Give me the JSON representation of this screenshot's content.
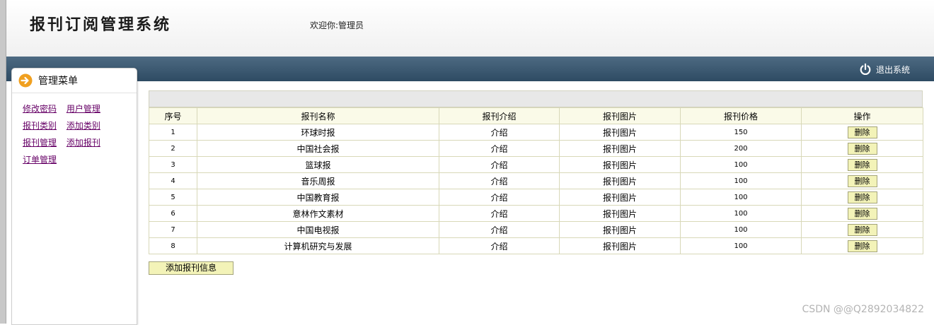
{
  "header": {
    "app_title": "报刊订阅管理系统",
    "welcome": "欢迎你:管理员"
  },
  "navbar": {
    "logout_label": "退出系统",
    "logout_icon": "power-icon"
  },
  "sidebar": {
    "title": "管理菜单",
    "title_icon": "arrow-right-circle-icon",
    "menu_rows": [
      [
        "修改密码",
        "用户管理"
      ],
      [
        "报刊类别",
        "添加类别"
      ],
      [
        "报刊管理",
        "添加报刊"
      ],
      [
        "订单管理"
      ]
    ]
  },
  "table": {
    "headers": [
      "序号",
      "报刊名称",
      "报刊介绍",
      "报刊图片",
      "报刊价格",
      "操作"
    ],
    "rows": [
      {
        "id": "1",
        "name": "环球时报",
        "intro": "介绍",
        "image": "报刊图片",
        "price": "150",
        "action": "删除"
      },
      {
        "id": "2",
        "name": "中国社会报",
        "intro": "介绍",
        "image": "报刊图片",
        "price": "200",
        "action": "删除"
      },
      {
        "id": "3",
        "name": "篮球报",
        "intro": "介绍",
        "image": "报刊图片",
        "price": "100",
        "action": "删除"
      },
      {
        "id": "4",
        "name": "音乐周报",
        "intro": "介绍",
        "image": "报刊图片",
        "price": "100",
        "action": "删除"
      },
      {
        "id": "5",
        "name": "中国教育报",
        "intro": "介绍",
        "image": "报刊图片",
        "price": "100",
        "action": "删除"
      },
      {
        "id": "6",
        "name": "意林作文素材",
        "intro": "介绍",
        "image": "报刊图片",
        "price": "100",
        "action": "删除"
      },
      {
        "id": "7",
        "name": "中国电视报",
        "intro": "介绍",
        "image": "报刊图片",
        "price": "100",
        "action": "删除"
      },
      {
        "id": "8",
        "name": "计算机研究与发展",
        "intro": "介绍",
        "image": "报刊图片",
        "price": "100",
        "action": "删除"
      }
    ]
  },
  "add_button_label": "添加报刊信息",
  "watermark": "CSDN @@Q2892034822",
  "colors": {
    "navbar": "#3b5870",
    "link": "#660066",
    "button": "#f3f3b8",
    "table_header": "#fafae8",
    "accent_icon": "#f0a020"
  }
}
